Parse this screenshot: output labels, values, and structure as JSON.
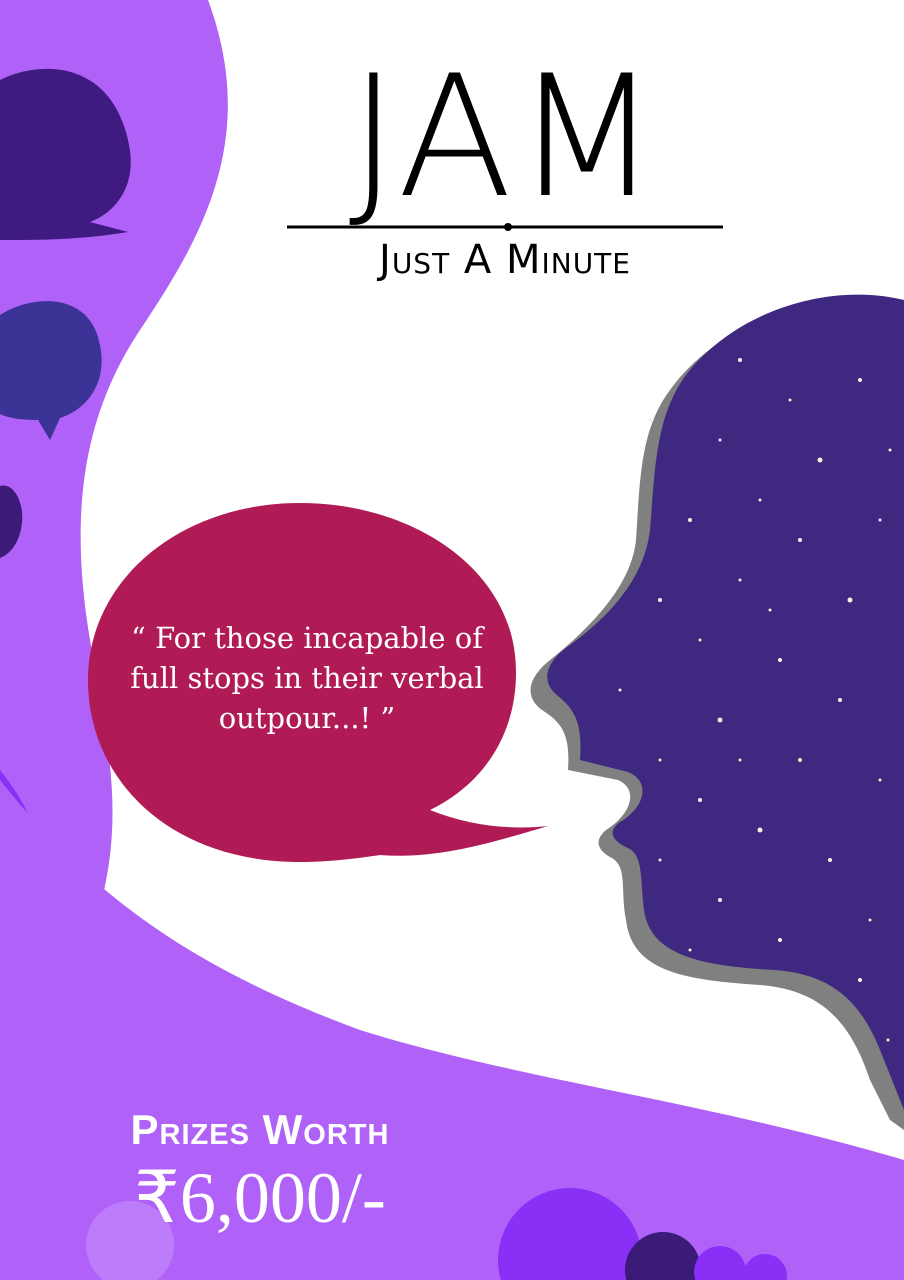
{
  "title": {
    "main": "JAM",
    "sub": "Just A Minute"
  },
  "quote": "“ For those incapable of full stops in their verbal outpour...! ”",
  "prizes": {
    "label": "Prizes Worth",
    "amount": "₹6,000/-"
  },
  "colors": {
    "purple_light": "#b062f8",
    "purple_bright": "#8a2ff6",
    "indigo": "#3f2980",
    "indigo_dark": "#3b1a78",
    "blue_bubble": "#3c3396",
    "bubble_red": "#b01b55",
    "shadow_gray": "#808080",
    "white": "#ffffff"
  },
  "icons": [
    "chat-bubble-icon",
    "head-silhouette",
    "speech-bubble"
  ]
}
